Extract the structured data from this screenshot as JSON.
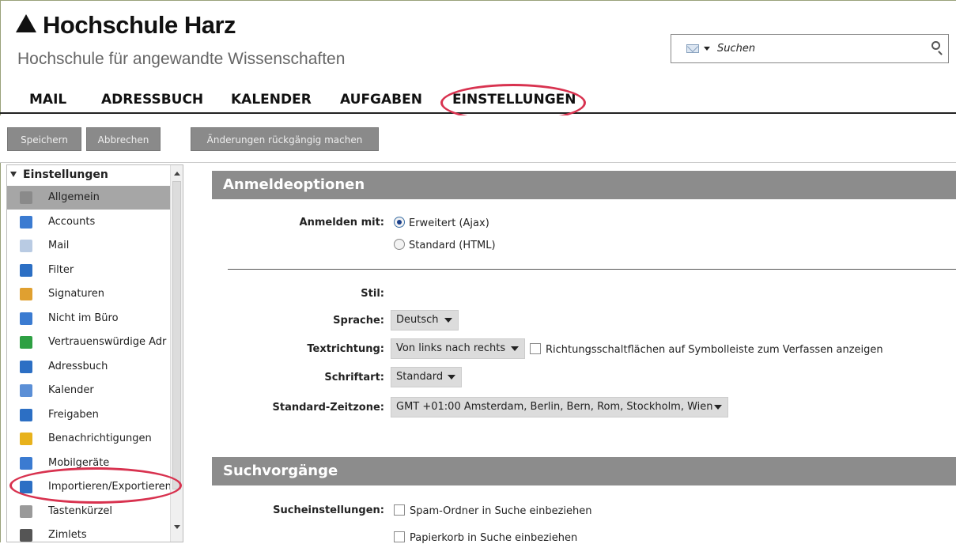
{
  "header": {
    "brand": "Hochschule Harz",
    "subtitle": "Hochschule für angewandte Wissenschaften",
    "search_placeholder": "Suchen"
  },
  "nav": [
    "MAIL",
    "ADRESSBUCH",
    "KALENDER",
    "AUFGABEN",
    "EINSTELLUNGEN"
  ],
  "toolbar": {
    "save": "Speichern",
    "cancel": "Abbrechen",
    "undo": "Änderungen rückgängig machen"
  },
  "sidebar": {
    "title": "Einstellungen",
    "items": [
      {
        "label": "Allgemein",
        "icon": "gear-icon",
        "color": "#8a8a8a"
      },
      {
        "label": "Accounts",
        "icon": "accounts-icon",
        "color": "#3b7bd1"
      },
      {
        "label": "Mail",
        "icon": "mail-icon",
        "color": "#b9cbe3"
      },
      {
        "label": "Filter",
        "icon": "filter-icon",
        "color": "#2c6fc4"
      },
      {
        "label": "Signaturen",
        "icon": "signature-icon",
        "color": "#e0a030"
      },
      {
        "label": "Nicht im Büro",
        "icon": "out-of-office-icon",
        "color": "#3b7bd1"
      },
      {
        "label": "Vertrauenswürdige Adr",
        "icon": "shield-icon",
        "color": "#2ea043"
      },
      {
        "label": "Adressbuch",
        "icon": "contact-icon",
        "color": "#2c6fc4"
      },
      {
        "label": "Kalender",
        "icon": "calendar-icon",
        "color": "#5b8fd6"
      },
      {
        "label": "Freigaben",
        "icon": "share-icon",
        "color": "#2c6fc4"
      },
      {
        "label": "Benachrichtigungen",
        "icon": "bell-icon",
        "color": "#e8b21c"
      },
      {
        "label": "Mobilgeräte",
        "icon": "mobile-icon",
        "color": "#3b7bd1"
      },
      {
        "label": "Importieren/Exportieren",
        "icon": "import-export-icon",
        "color": "#2c6fc4"
      },
      {
        "label": "Tastenkürzel",
        "icon": "keyboard-icon",
        "color": "#9a9a9a"
      },
      {
        "label": "Zimlets",
        "icon": "zimlet-icon",
        "color": "#555555"
      }
    ]
  },
  "login": {
    "section_title": "Anmeldeoptionen",
    "label": "Anmelden mit:",
    "option_advanced": "Erweitert (Ajax)",
    "option_standard": "Standard (HTML)"
  },
  "prefs": {
    "style_label": "Stil:",
    "language_label": "Sprache:",
    "language_value": "Deutsch",
    "direction_label": "Textrichtung:",
    "direction_value": "Von links nach rechts",
    "direction_checkbox": "Richtungsschaltflächen auf Symbolleiste zum Verfassen anzeigen",
    "font_label": "Schriftart:",
    "font_value": "Standard",
    "timezone_label": "Standard-Zeitzone:",
    "timezone_value": "GMT +01:00 Amsterdam, Berlin, Bern, Rom, Stockholm, Wien"
  },
  "search_section": {
    "title": "Suchvorgänge",
    "label": "Sucheinstellungen:",
    "spam": "Spam-Ordner in Suche einbeziehen",
    "trash": "Papierkorb in Suche einbeziehen"
  }
}
